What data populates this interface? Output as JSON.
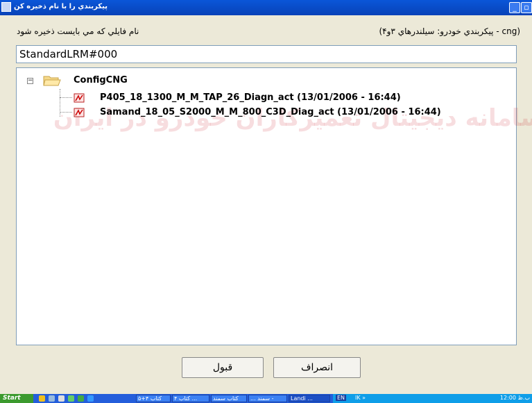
{
  "window": {
    "title": "پيکربندي را با نام ذخيره کن",
    "min_label": "_",
    "max_label": "▫",
    "close_label": "x"
  },
  "labels": {
    "file_name_prompt": "نام فايلي که مي بايست ذخيره شود",
    "config_info": "(cng - پيکربندي خودرو: سيلندرهاي ۳و۴)"
  },
  "filename_input": {
    "value": "StandardLRM#000"
  },
  "watermark": "سامانه دیجیتال تعمیرکاران خودرو در ایران",
  "tree": {
    "root": {
      "label": "ConfigCNG",
      "expander": "−"
    },
    "files": [
      {
        "label": "P405_18_1300_M_M_TAP_26_Diagn_act (13/01/2006 - 16:44)"
      },
      {
        "label": "Samand_18_05_S2000_M_M_800_C3D_Diag_act (13/01/2006 - 16:44)"
      }
    ]
  },
  "buttons": {
    "ok": "قبول",
    "cancel": "انصراف"
  },
  "taskbar": {
    "start": "Start",
    "tasks": [
      "كتاب ۴+۵",
      "كتاب ۴ ...",
      "كتاب سمند",
      "... سمند -",
      "Landi ..."
    ],
    "lang": "EN",
    "ik": "IK »",
    "clock": "12:00 ب.ظ"
  },
  "colors": {
    "titlebar": "#0a56d8",
    "dialog_bg": "#ece9d8",
    "input_border": "#7f9db9",
    "watermark": "#c81e28"
  }
}
